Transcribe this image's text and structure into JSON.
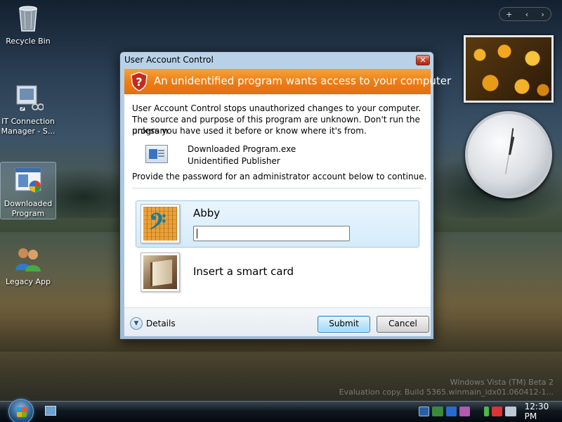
{
  "desktop": {
    "icons": [
      {
        "label": "Recycle Bin"
      },
      {
        "label": "IT Connection Manager - S..."
      },
      {
        "label": "Downloaded Program"
      },
      {
        "label": "Legacy App"
      }
    ]
  },
  "sidebar": {
    "toolbar": {
      "add": "+",
      "prev": "‹",
      "next": "›"
    }
  },
  "watermark": {
    "line1": "Windows Vista (TM) Beta 2",
    "line2": "Evaluation copy. Build 5365.winmain_idx01.060412-1..."
  },
  "taskbar": {
    "time": "12:30 PM"
  },
  "uac": {
    "title": "User Account Control",
    "close": "✕",
    "banner": "An unidentified program wants access to your computer",
    "message_lines": [
      "User Account Control stops unauthorized changes to your computer.",
      "The source and purpose of this program are unknown.  Don't run the program",
      "unless you have used it before or know where it's from."
    ],
    "program_name": "Downloaded Program.exe",
    "publisher": "Unidentified Publisher",
    "prompt": "Provide the password for an administrator account below to continue.",
    "accounts": [
      {
        "name": "Abby",
        "password_value": ""
      },
      {
        "name": "Insert a smart card"
      }
    ],
    "details_label": "Details",
    "submit_label": "Submit",
    "cancel_label": "Cancel"
  },
  "colors": {
    "banner": "#ec7c14",
    "selected_tile": "#d5ebfa",
    "accent_border": "#3c7fb1"
  }
}
